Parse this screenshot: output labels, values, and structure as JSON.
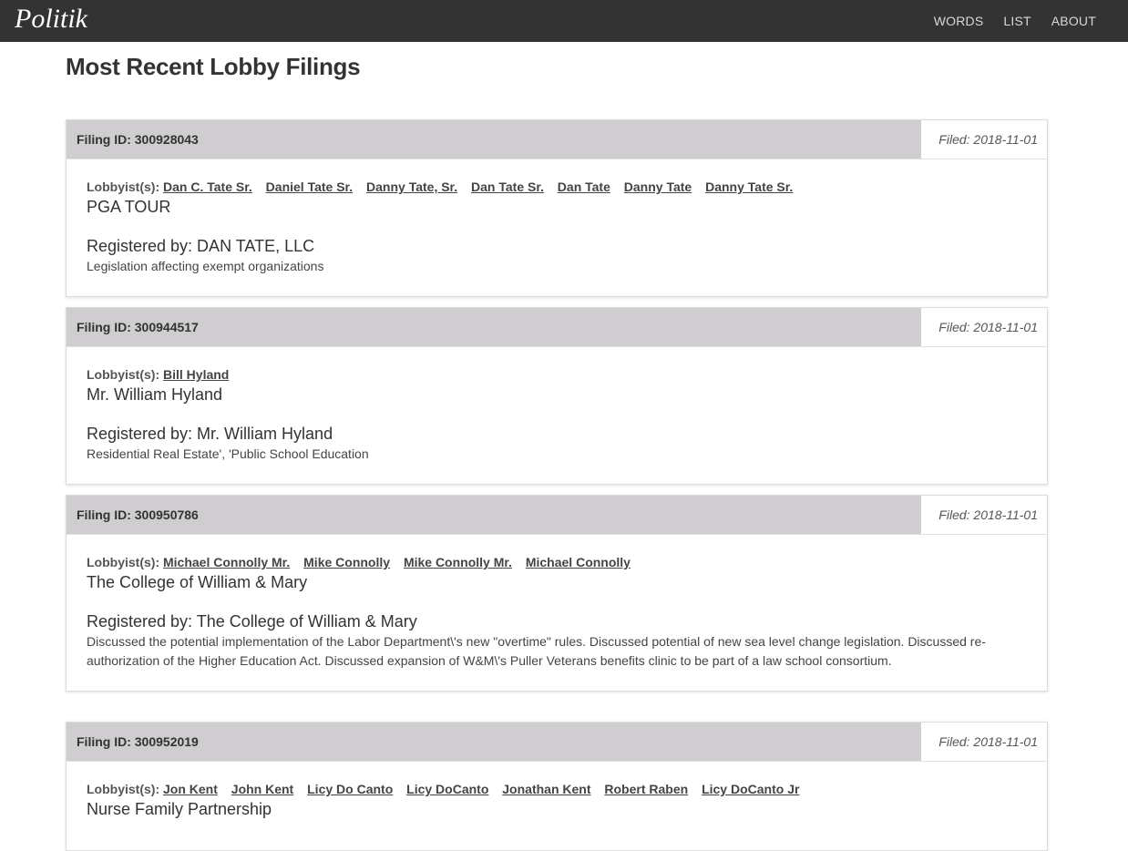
{
  "brand": "Politik",
  "nav": [
    {
      "label": "WORDS"
    },
    {
      "label": "LIST"
    },
    {
      "label": "ABOUT"
    }
  ],
  "page_title": "Most Recent Lobby Filings",
  "filings": [
    {
      "id_text": "Filing ID: 300928043",
      "filed_text": "Filed: 2018-11-01",
      "lobbyist_label": "Lobbyist(s):",
      "lobbyists": [
        "Dan C. Tate Sr.",
        "Daniel Tate Sr.",
        "Danny Tate, Sr.",
        "Dan Tate Sr.",
        "Dan Tate",
        "Danny Tate",
        "Danny Tate Sr."
      ],
      "client": "PGA TOUR",
      "registered_by": "Registered by: DAN TATE, LLC",
      "issues": "Legislation affecting exempt organizations"
    },
    {
      "id_text": "Filing ID: 300944517",
      "filed_text": "Filed: 2018-11-01",
      "lobbyist_label": "Lobbyist(s):",
      "lobbyists": [
        "Bill Hyland"
      ],
      "client": "Mr. William Hyland",
      "registered_by": "Registered by: Mr. William Hyland",
      "issues": "Residential Real Estate', 'Public School Education"
    },
    {
      "id_text": "Filing ID: 300950786",
      "filed_text": "Filed: 2018-11-01",
      "lobbyist_label": "Lobbyist(s):",
      "lobbyists": [
        "Michael Connolly Mr.",
        "Mike Connolly",
        "Mike Connolly Mr.",
        "Michael Connolly"
      ],
      "client": "The College of William & Mary",
      "registered_by": "Registered by: The College of William & Mary",
      "issues": "Discussed the potential implementation of the Labor Department\\'s new \"overtime\" rules. Discussed potential of new sea level change legislation. Discussed re-authorization of the Higher Education Act. Discussed expansion of W&M\\'s Puller Veterans benefits clinic to be part of a law school consortium."
    },
    {
      "id_text": "Filing ID: 300952019",
      "filed_text": "Filed: 2018-11-01",
      "lobbyist_label": "Lobbyist(s):",
      "lobbyists": [
        "Jon Kent",
        "John Kent",
        "Licy Do Canto",
        "Licy DoCanto",
        "Jonathan Kent",
        "Robert Raben",
        "Licy DoCanto Jr"
      ],
      "client": "Nurse Family Partnership",
      "registered_by": "",
      "issues": ""
    }
  ]
}
